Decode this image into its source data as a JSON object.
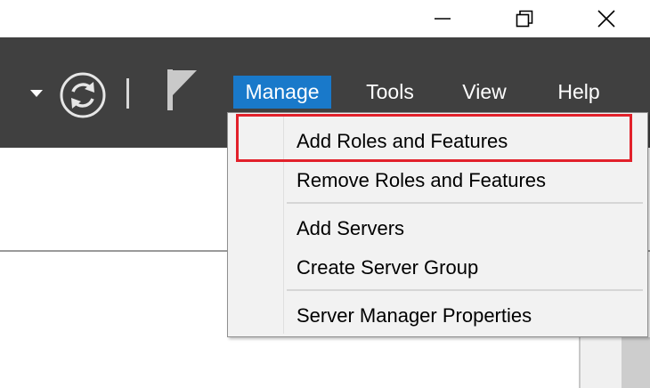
{
  "window_controls": {
    "minimize": "minimize",
    "maximize": "restore",
    "close": "close"
  },
  "header": {
    "icons": [
      "dropdown-arrow-icon",
      "refresh-icon",
      "flag-icon"
    ],
    "menu": [
      {
        "label": "Manage",
        "active": true
      },
      {
        "label": "Tools"
      },
      {
        "label": "View"
      },
      {
        "label": "Help"
      }
    ]
  },
  "manage_menu": {
    "items": [
      {
        "label": "Add Roles and Features",
        "highlighted": true
      },
      {
        "label": "Remove Roles and Features"
      },
      {
        "label": "Add Servers"
      },
      {
        "label": "Create Server Group"
      },
      {
        "label": "Server Manager Properties"
      }
    ]
  },
  "colors": {
    "header_bg": "#404040",
    "active_menu_bg": "#1979ca",
    "highlight_border": "#e2212b",
    "menu_bg": "#f2f2f2"
  }
}
